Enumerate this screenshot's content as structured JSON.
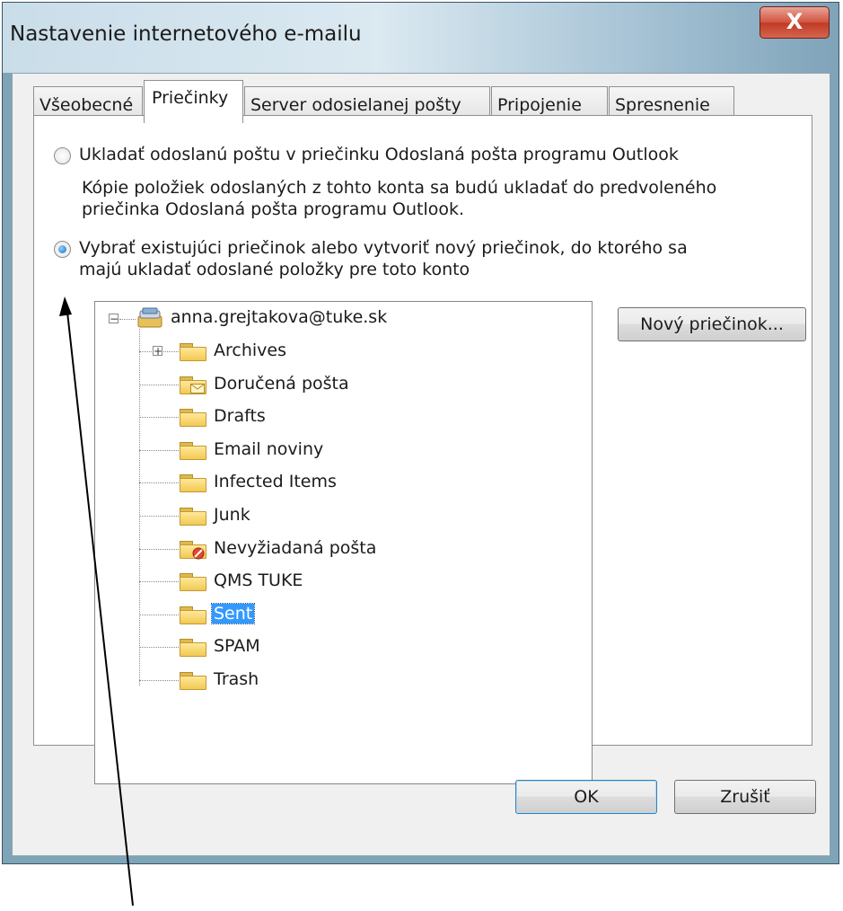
{
  "window": {
    "title": "Nastavenie internetového e-mailu",
    "close_label": "X"
  },
  "tabs": [
    {
      "label": "Všeobecné",
      "active": false
    },
    {
      "label": "Priečinky",
      "active": true
    },
    {
      "label": "Server odosielanej pošty",
      "active": false
    },
    {
      "label": "Pripojenie",
      "active": false
    },
    {
      "label": "Spresnenie",
      "active": false
    }
  ],
  "options": {
    "save_default": {
      "label": "Ukladať odoslanú poštu v priečinku Odoslaná pošta programu Outlook",
      "checked": false,
      "description_line1": "Kópie položiek odoslaných z tohto konta sa budú ukladať do predvoleného",
      "description_line2": "priečinka Odoslaná pošta programu Outlook."
    },
    "select_folder": {
      "label_line1": "Vybrať existujúci priečinok alebo vytvoriť nový priečinok, do ktorého sa",
      "label_line2": "majú ukladať odoslané položky pre toto konto",
      "checked": true
    }
  },
  "folder_tree": {
    "root": "anna.grejtakova@tuke.sk",
    "folders": [
      {
        "name": "Archives",
        "icon": "folder-icon",
        "expandable": true
      },
      {
        "name": "Doručená pošta",
        "icon": "inbox-folder-icon"
      },
      {
        "name": "Drafts",
        "icon": "folder-icon"
      },
      {
        "name": "Email noviny",
        "icon": "folder-icon"
      },
      {
        "name": "Infected Items",
        "icon": "folder-icon"
      },
      {
        "name": "Junk",
        "icon": "folder-icon"
      },
      {
        "name": "Nevyžiadaná pošta",
        "icon": "junk-folder-icon"
      },
      {
        "name": "QMS TUKE",
        "icon": "folder-icon"
      },
      {
        "name": "Sent",
        "icon": "folder-icon",
        "selected": true
      },
      {
        "name": "SPAM",
        "icon": "folder-icon"
      },
      {
        "name": "Trash",
        "icon": "folder-icon"
      }
    ]
  },
  "buttons": {
    "new_folder": "Nový priečinok...",
    "ok": "OK",
    "cancel": "Zrušiť"
  },
  "colors": {
    "selection": "#3399ff",
    "close_button": "#c9452f",
    "dialog_background": "#f0f0f0"
  }
}
